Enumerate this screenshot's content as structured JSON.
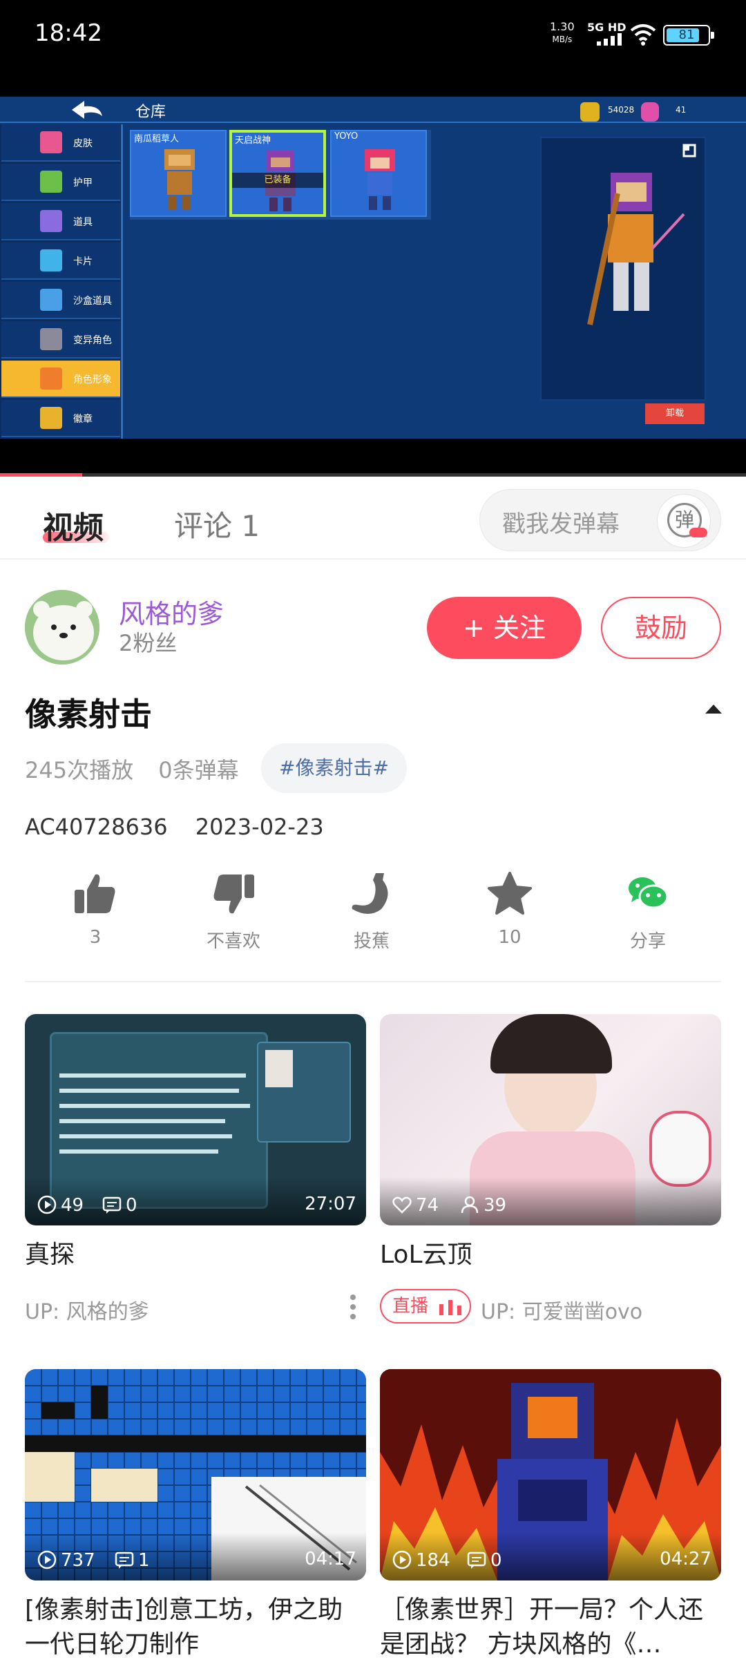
{
  "status_bar": {
    "time": "18:42",
    "net_speed": "1.30",
    "net_unit": "MB/s",
    "network": "5G HD",
    "battery": "81"
  },
  "player": {
    "game": {
      "title": "仓库",
      "coins": "54028",
      "gems": "41",
      "sidebar": [
        "皮肤",
        "护甲",
        "道具",
        "卡片",
        "沙盒道具",
        "变异角色",
        "角色形象",
        "徽章"
      ],
      "active_sidebar_index": 6,
      "cards": [
        "南瓜稻草人",
        "天启战神",
        "YOYO"
      ],
      "equipped_label": "已装备",
      "unequip_label": "卸载"
    },
    "progress_fraction": 0.11
  },
  "tabs": {
    "video": "视频",
    "comments": "评论 1",
    "danmaku_placeholder": "戳我发弹幕",
    "danmaku_button": "弹"
  },
  "uploader": {
    "name": "风格的爹",
    "fans": "2粉丝",
    "follow": "+ 关注",
    "encourage": "鼓励"
  },
  "video": {
    "title": "像素射击",
    "plays": "245次播放",
    "danmaku_count": "0条弹幕",
    "tag": "#像素射击#",
    "ac_id": "AC40728636",
    "date": "2023-02-23"
  },
  "actions": [
    {
      "icon": "thumbs-up-icon",
      "label": "3"
    },
    {
      "icon": "thumbs-down-icon",
      "label": "不喜欢"
    },
    {
      "icon": "banana-icon",
      "label": "投蕉"
    },
    {
      "icon": "star-icon",
      "label": "10"
    },
    {
      "icon": "wechat-icon",
      "label": "分享"
    }
  ],
  "recommendations": [
    {
      "title": "真探",
      "plays": "49",
      "comments": "0",
      "duration": "27:07",
      "up": "UP: 风格的爹",
      "live": false
    },
    {
      "title": "LoL云顶",
      "likes": "74",
      "viewers": "39",
      "up": "UP: 可爱凿凿ovo",
      "live": true,
      "live_label": "直播"
    },
    {
      "title": "[像素射击]创意工坊，伊之助一代日轮刀制作",
      "plays": "737",
      "comments": "1",
      "duration": "04:17"
    },
    {
      "title": "［像素世界］开一局？个人还是团战？ 方块风格的《…",
      "plays": "184",
      "comments": "0",
      "duration": "04:27"
    }
  ],
  "colors": {
    "accent": "#fd4c5d",
    "uploader_name": "#9b59d6",
    "tag_text": "#4b6ea6"
  }
}
